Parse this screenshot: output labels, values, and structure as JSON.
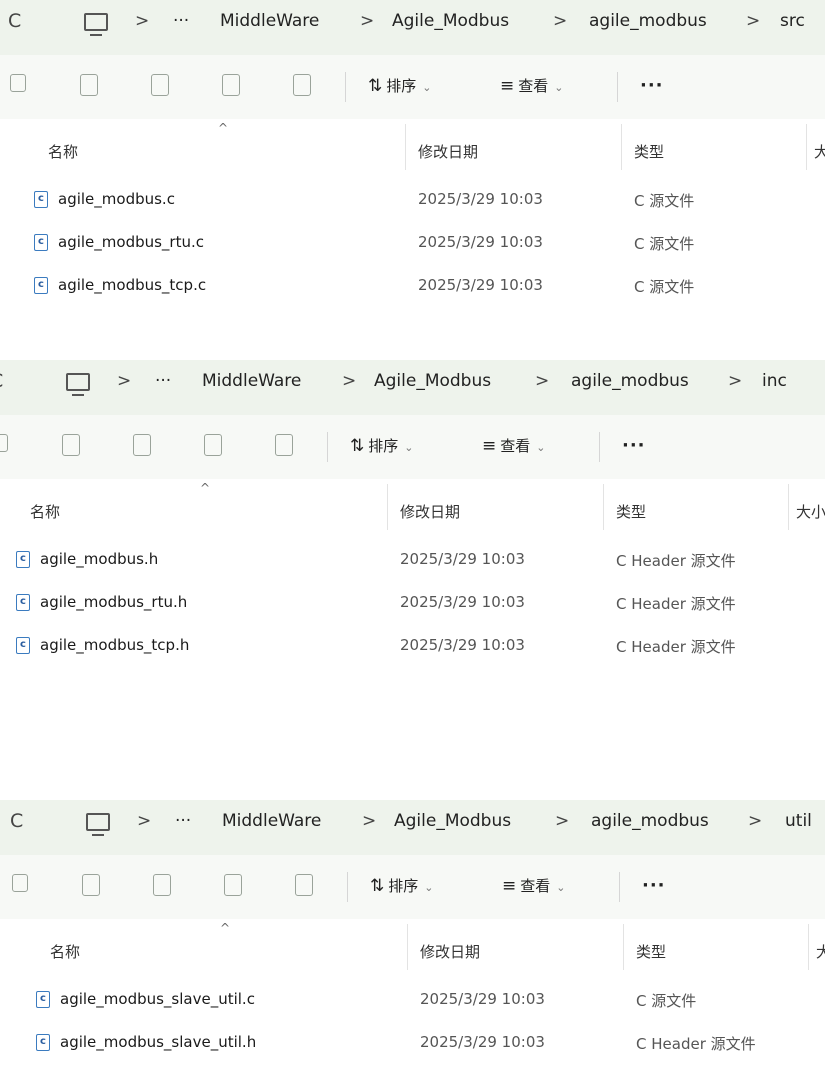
{
  "panels": [
    {
      "breadcrumb": [
        "MiddleWare",
        "Agile_Modbus",
        "agile_modbus",
        "src"
      ],
      "files": [
        {
          "name": "agile_modbus.c",
          "date": "2025/3/29 10:03",
          "type": "C 源文件"
        },
        {
          "name": "agile_modbus_rtu.c",
          "date": "2025/3/29 10:03",
          "type": "C 源文件"
        },
        {
          "name": "agile_modbus_tcp.c",
          "date": "2025/3/29 10:03",
          "type": "C 源文件"
        }
      ]
    },
    {
      "breadcrumb": [
        "MiddleWare",
        "Agile_Modbus",
        "agile_modbus",
        "inc"
      ],
      "files": [
        {
          "name": "agile_modbus.h",
          "date": "2025/3/29 10:03",
          "type": "C Header 源文件"
        },
        {
          "name": "agile_modbus_rtu.h",
          "date": "2025/3/29 10:03",
          "type": "C Header 源文件"
        },
        {
          "name": "agile_modbus_tcp.h",
          "date": "2025/3/29 10:03",
          "type": "C Header 源文件"
        }
      ]
    },
    {
      "breadcrumb": [
        "MiddleWare",
        "Agile_Modbus",
        "agile_modbus",
        "util"
      ],
      "files": [
        {
          "name": "agile_modbus_slave_util.c",
          "date": "2025/3/29 10:03",
          "type": "C 源文件"
        },
        {
          "name": "agile_modbus_slave_util.h",
          "date": "2025/3/29 10:03",
          "type": "C Header 源文件"
        }
      ]
    }
  ],
  "toolbar": {
    "sort": "排序",
    "view": "查看",
    "more": "···"
  },
  "columns": {
    "name": "名称",
    "date": "修改日期",
    "type": "类型",
    "size": "大小"
  },
  "ui": {
    "refresh_glyph": "C",
    "chevron": ">",
    "ellipsis": "···",
    "sort_glyph": "⇅",
    "view_glyph": "≡",
    "dropdown": "⌄",
    "caret_up": "^",
    "file_glyph": "c"
  },
  "colors": {
    "address_bar_bg": "#eef3ec",
    "toolbar_bg": "#f7f9f6",
    "file_icon": "#3b7bbf"
  },
  "icons": [
    "refresh-icon",
    "computer-icon",
    "copy-icon",
    "paste-icon",
    "rename-icon",
    "share-icon",
    "delete-icon",
    "sort-icon",
    "view-icon",
    "c-file-icon"
  ]
}
